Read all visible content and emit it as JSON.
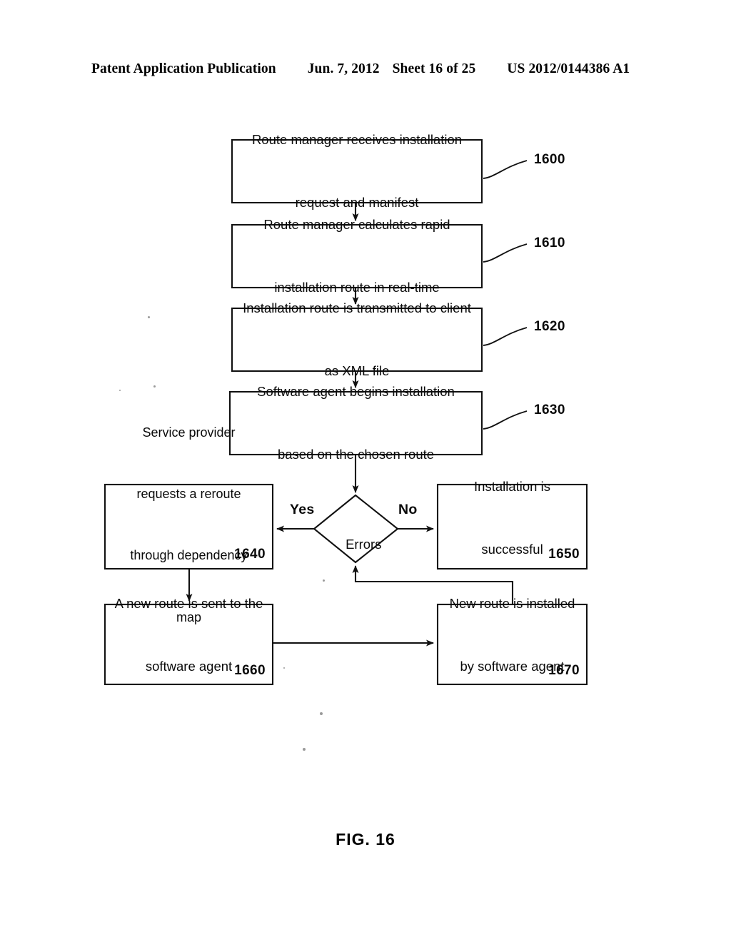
{
  "page": {
    "header": {
      "publication": "Patent Application Publication",
      "date": "Jun. 7, 2012",
      "sheet": "Sheet 16 of 25",
      "doc_number": "US 2012/0144386 A1"
    },
    "figure_caption": "FIG. 16",
    "background_color": "#ffffff",
    "ink_color": "#0a0a0a"
  },
  "flowchart": {
    "type": "flowchart",
    "title": "FIG. 16",
    "nodes": [
      {
        "id": "n1600",
        "ref": "1600",
        "shape": "process",
        "ref_position": "leader-right",
        "lines": [
          "Route manager receives installation",
          "request and manifest"
        ]
      },
      {
        "id": "n1610",
        "ref": "1610",
        "shape": "process",
        "ref_position": "leader-right",
        "lines": [
          "Route manager calculates rapid",
          "installation route in real-time"
        ]
      },
      {
        "id": "n1620",
        "ref": "1620",
        "shape": "process",
        "ref_position": "leader-right",
        "lines": [
          "Installation route is transmitted to client",
          "as XML file"
        ]
      },
      {
        "id": "n1630",
        "ref": "1630",
        "shape": "process",
        "ref_position": "leader-right",
        "lines": [
          "Software agent begins installation",
          "based on the chosen route"
        ]
      },
      {
        "id": "nErrors",
        "ref": "",
        "shape": "decision",
        "ref_position": "none",
        "lines": [
          "Errors"
        ]
      },
      {
        "id": "n1640",
        "ref": "1640",
        "shape": "process",
        "ref_position": "inside-bottom-right",
        "lines": [
          "Service provider",
          "requests a reroute",
          "through dependency",
          "map"
        ]
      },
      {
        "id": "n1650",
        "ref": "1650",
        "shape": "process",
        "ref_position": "inside-bottom-right",
        "lines": [
          "Installation is",
          "successful"
        ]
      },
      {
        "id": "n1660",
        "ref": "1660",
        "shape": "process",
        "ref_position": "inside-bottom-right",
        "lines": [
          "A new route is sent to the",
          "software agent"
        ]
      },
      {
        "id": "n1670",
        "ref": "1670",
        "shape": "process",
        "ref_position": "inside-bottom-right",
        "lines": [
          "New route is installed",
          "by software agent"
        ]
      }
    ],
    "edges": [
      {
        "from": "n1600",
        "to": "n1610",
        "label": ""
      },
      {
        "from": "n1610",
        "to": "n1620",
        "label": ""
      },
      {
        "from": "n1620",
        "to": "n1630",
        "label": ""
      },
      {
        "from": "n1630",
        "to": "nErrors",
        "label": ""
      },
      {
        "from": "nErrors",
        "to": "n1640",
        "label": "Yes"
      },
      {
        "from": "nErrors",
        "to": "n1650",
        "label": "No"
      },
      {
        "from": "n1640",
        "to": "n1660",
        "label": ""
      },
      {
        "from": "n1660",
        "to": "n1670",
        "label": ""
      },
      {
        "from": "n1670",
        "to": "nErrors",
        "label": ""
      }
    ],
    "branch_labels": {
      "yes": "Yes",
      "no": "No"
    }
  }
}
